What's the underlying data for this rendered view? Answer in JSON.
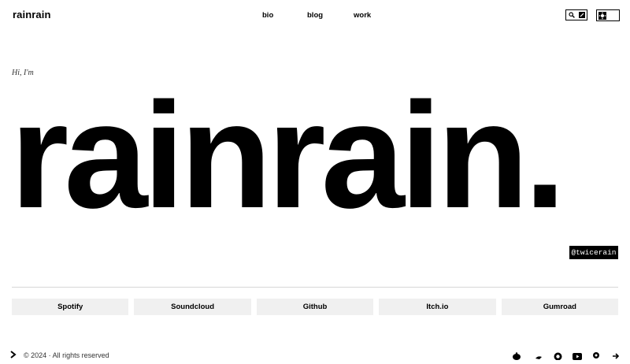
{
  "header": {
    "brand": "rainrain",
    "nav": [
      {
        "label": "bio"
      },
      {
        "label": "blog"
      },
      {
        "label": "work"
      }
    ],
    "tools": [
      "search-icon",
      "edit-icon"
    ],
    "theme_toggle": "theme-icon"
  },
  "hero": {
    "greeting": "Hi, I'm",
    "name": "rainrain.",
    "handle": "@twicerain"
  },
  "links": [
    {
      "label": "Spotify"
    },
    {
      "label": "Soundcloud"
    },
    {
      "label": "Github"
    },
    {
      "label": "Itch.io"
    },
    {
      "label": "Gumroad"
    }
  ],
  "footer": {
    "copyright": "© 2024 · All rights reserved",
    "social_icons": [
      "reddit-icon",
      "bird-icon",
      "github-icon",
      "youtube-icon",
      "pin-icon",
      "arrow-right-icon"
    ]
  },
  "colors": {
    "background": "#ffffff",
    "text": "#000000",
    "button_bg": "#f0f0f0",
    "divider": "#d6d6d6"
  }
}
